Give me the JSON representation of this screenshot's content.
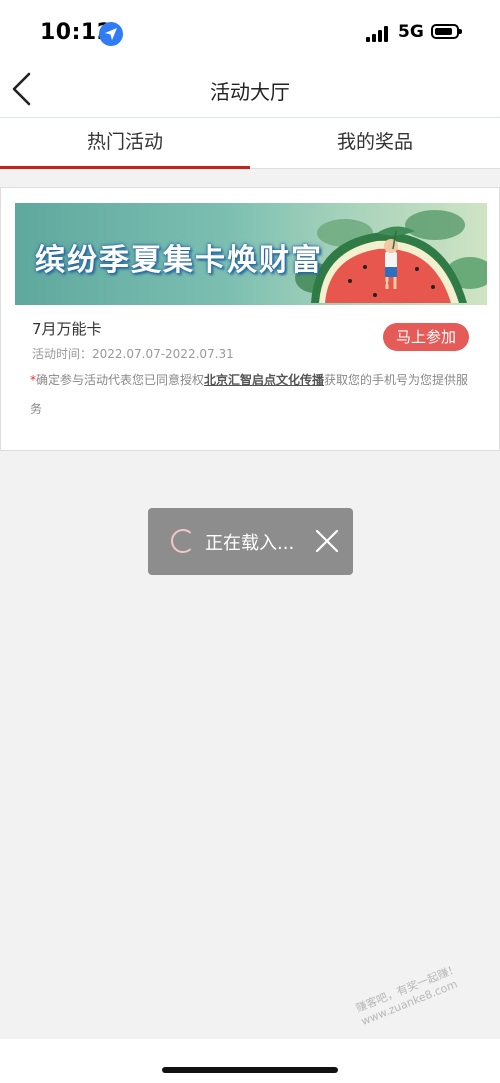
{
  "status_bar": {
    "time": "10:12",
    "network": "5G"
  },
  "nav": {
    "title": "活动大厅"
  },
  "tabs": [
    {
      "label": "热门活动",
      "active": true
    },
    {
      "label": "我的奖品",
      "active": false
    }
  ],
  "activity": {
    "banner_text": "缤纷季夏集卡焕财富",
    "name": "7月万能卡",
    "time": "活动时间：2022.07.07-2022.07.31",
    "join_label": "马上参加",
    "notice_star": "*",
    "notice_before": "确定参与活动代表您已同意授权",
    "notice_company": "北京汇智启点文化传播",
    "notice_after": "获取您的手机号为您提供服务"
  },
  "toast": {
    "text": "正在载入..."
  },
  "watermark": {
    "line1": "赚客吧，有奖一起赚！",
    "line2": "www.zuanke8.com"
  },
  "colors": {
    "accent_red": "#c7211e",
    "join_button": "#e55b57",
    "toast_bg": "#8d8d8d",
    "page_bg": "#f2f2f2"
  }
}
